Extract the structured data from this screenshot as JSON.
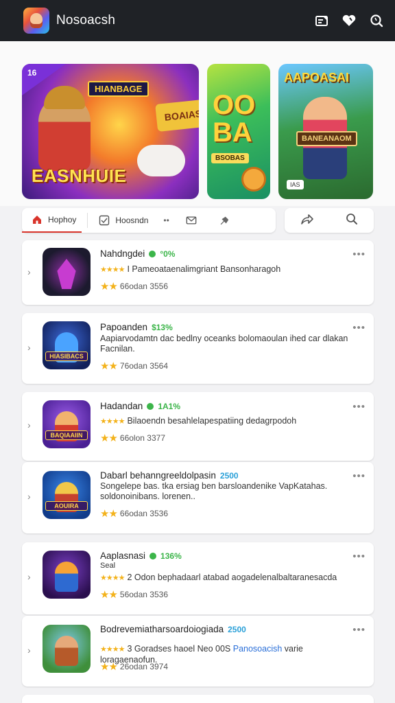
{
  "header": {
    "title": "Nosoacsh",
    "icons": [
      "store-icon",
      "heart-icon",
      "search-icon"
    ]
  },
  "banners": {
    "b1_corner": "16",
    "b1_top": "HIANBAGE",
    "b1_side": "BOAIAS",
    "b1_title": "EASNHUIE",
    "b2_big": "OO\nBA",
    "b2_sub": "BSOBAS",
    "b3_title": "AAPOASAI",
    "b3_sign": "BANEANAOM",
    "b3_small": "IAS"
  },
  "tabs": {
    "home_label": "Hophoy",
    "second_label": "Hoosndn",
    "dots": "••"
  },
  "apps": [
    {
      "name": "Nahdngdei",
      "pct": "°0%",
      "pct_color": "#3cb54a",
      "desc": "I Pameoataenalimgriant Bansonharagoh",
      "rating": "66odan",
      "count": "3556",
      "icon_bg": "#1c1a2e",
      "icon_accent": "#c73cd0",
      "icon_tag": ""
    },
    {
      "name": "Papoanden",
      "pct": "$13%",
      "pct_color": "#3cb54a",
      "desc": "Aapiarvodamtn dac bedlny oceanks bolomaoulan ihed car dlakan Facnilan.",
      "rating": "76odan",
      "count": "3564",
      "icon_bg": "#1c2f7a",
      "icon_accent": "#4aa3ff",
      "icon_tag": "HIASIBACS"
    },
    {
      "name": "Hadandan",
      "pct": "1A1%",
      "pct_color": "#3cb54a",
      "desc": "Bilaoendn besahlelapespatiing dedagrpodoh",
      "rating": "66olon",
      "count": "3377",
      "icon_bg": "#6a2fc4",
      "icon_accent": "#f2b36e",
      "icon_tag": "BAQIAAIIN"
    },
    {
      "name": "Dabarl behanngreeldolpasin",
      "pct": "2500",
      "pct_color": "#2aa0d8",
      "desc": "Songelepe bas. tka ersiag ben barsloandenike VapKatahas. soldonoinibans. lorenen..",
      "rating": "66odan",
      "count": "3536",
      "icon_bg": "#1a55b5",
      "icon_accent": "#f1c84a",
      "icon_tag": "AOUIRA"
    },
    {
      "name": "Aaplasnasi",
      "pct": "136%",
      "pct_color": "#3cb54a",
      "sub": "Seal",
      "desc": "2 Odon bephadaarl atabad aogadelenalbaltaranesacda",
      "rating": "56odan",
      "count": "3536",
      "icon_bg": "#3a1b6a",
      "icon_accent": "#f7a336",
      "icon_tag": ""
    },
    {
      "name": "Bodrevemiatharsoardoiogiada",
      "pct": "2500",
      "pct_color": "#2aa0d8",
      "desc_a": "3 Goradses haoel Neo 00S ",
      "desc_link": "Panosoacish",
      "desc_b": " varie loragaenaofun.",
      "rating": "26odan",
      "count": "3974",
      "icon_bg": "#3f8f3b",
      "icon_accent": "#b65a2a",
      "icon_tag": ""
    }
  ]
}
